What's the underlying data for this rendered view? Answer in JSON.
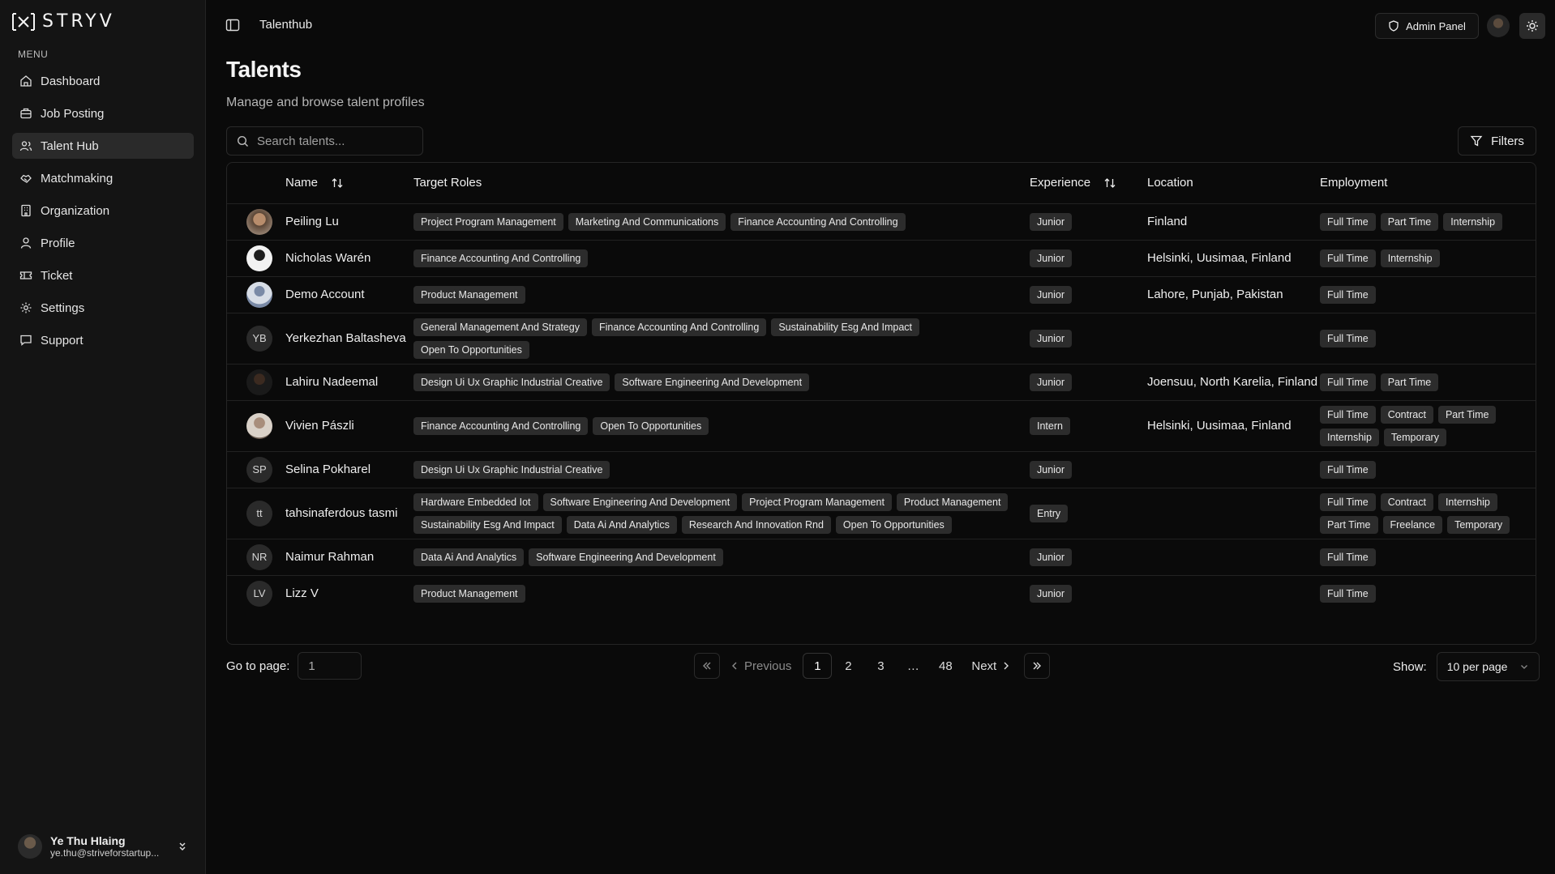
{
  "app": {
    "logo_text": "STRYV"
  },
  "sidebar": {
    "menu_label": "MENU",
    "items": [
      {
        "label": "Dashboard",
        "icon": "home-icon",
        "active": false
      },
      {
        "label": "Job Posting",
        "icon": "briefcase-icon",
        "active": false
      },
      {
        "label": "Talent Hub",
        "icon": "users-icon",
        "active": true
      },
      {
        "label": "Matchmaking",
        "icon": "handshake-icon",
        "active": false
      },
      {
        "label": "Organization",
        "icon": "building-icon",
        "active": false
      },
      {
        "label": "Profile",
        "icon": "user-icon",
        "active": false
      },
      {
        "label": "Ticket",
        "icon": "ticket-icon",
        "active": false
      },
      {
        "label": "Settings",
        "icon": "gear-icon",
        "active": false
      },
      {
        "label": "Support",
        "icon": "message-icon",
        "active": false
      }
    ],
    "user": {
      "name": "Ye Thu Hlaing",
      "email": "ye.thu@striveforstartup..."
    }
  },
  "header": {
    "breadcrumb": "Talenthub",
    "admin_button": "Admin Panel"
  },
  "page": {
    "title": "Talents",
    "subtitle": "Manage and browse talent profiles",
    "search_placeholder": "Search talents...",
    "filters_label": "Filters"
  },
  "table": {
    "columns": [
      "Name",
      "Target Roles",
      "Experience",
      "Location",
      "Employment"
    ],
    "rows": [
      {
        "avatar": "photo1",
        "initials": "",
        "name": "Peiling Lu",
        "roles": [
          "Project Program Management",
          "Marketing And Communications",
          "Finance Accounting And Controlling"
        ],
        "experience": "Junior",
        "location": "Finland",
        "employment": [
          "Full Time",
          "Part Time",
          "Internship"
        ]
      },
      {
        "avatar": "photo2",
        "initials": "",
        "name": "Nicholas Warén",
        "roles": [
          "Finance Accounting And Controlling"
        ],
        "experience": "Junior",
        "location": "Helsinki, Uusimaa, Finland",
        "employment": [
          "Full Time",
          "Internship"
        ]
      },
      {
        "avatar": "photo3",
        "initials": "",
        "name": "Demo Account",
        "roles": [
          "Product Management"
        ],
        "experience": "Junior",
        "location": "Lahore, Punjab, Pakistan",
        "employment": [
          "Full Time"
        ]
      },
      {
        "avatar": "",
        "initials": "YB",
        "name": "Yerkezhan Baltasheva",
        "roles": [
          "General Management And Strategy",
          "Finance Accounting And Controlling",
          "Sustainability Esg And Impact",
          "Open To Opportunities"
        ],
        "experience": "Junior",
        "location": "",
        "employment": [
          "Full Time"
        ]
      },
      {
        "avatar": "photo4",
        "initials": "",
        "name": "Lahiru Nadeemal",
        "roles": [
          "Design Ui Ux Graphic Industrial Creative",
          "Software Engineering And Development"
        ],
        "experience": "Junior",
        "location": "Joensuu, North Karelia, Finland",
        "employment": [
          "Full Time",
          "Part Time"
        ]
      },
      {
        "avatar": "photo5",
        "initials": "",
        "name": "Vivien Pászli",
        "roles": [
          "Finance Accounting And Controlling",
          "Open To Opportunities"
        ],
        "experience": "Intern",
        "location": "Helsinki, Uusimaa, Finland",
        "employment": [
          "Full Time",
          "Contract",
          "Part Time",
          "Internship",
          "Temporary"
        ]
      },
      {
        "avatar": "",
        "initials": "SP",
        "name": "Selina Pokharel",
        "roles": [
          "Design Ui Ux Graphic Industrial Creative"
        ],
        "experience": "Junior",
        "location": "",
        "employment": [
          "Full Time"
        ]
      },
      {
        "avatar": "",
        "initials": "tt",
        "name": "tahsinaferdous tasmi",
        "roles": [
          "Hardware Embedded Iot",
          "Software Engineering And Development",
          "Project Program Management",
          "Product Management",
          "Sustainability Esg And Impact",
          "Data Ai And Analytics",
          "Research And Innovation Rnd",
          "Open To Opportunities"
        ],
        "experience": "Entry",
        "location": "",
        "employment": [
          "Full Time",
          "Contract",
          "Internship",
          "Part Time",
          "Freelance",
          "Temporary"
        ]
      },
      {
        "avatar": "",
        "initials": "NR",
        "name": "Naimur Rahman",
        "roles": [
          "Data Ai And Analytics",
          "Software Engineering And Development"
        ],
        "experience": "Junior",
        "location": "",
        "employment": [
          "Full Time"
        ]
      },
      {
        "avatar": "",
        "initials": "LV",
        "name": "Lizz V",
        "roles": [
          "Product Management"
        ],
        "experience": "Junior",
        "location": "",
        "employment": [
          "Full Time"
        ]
      }
    ]
  },
  "pagination": {
    "goto_label": "Go to page:",
    "goto_value": "1",
    "previous": "Previous",
    "next": "Next",
    "pages": [
      "1",
      "2",
      "3",
      "…",
      "48"
    ],
    "current": "1",
    "show_label": "Show:",
    "per_page": "10 per page"
  }
}
